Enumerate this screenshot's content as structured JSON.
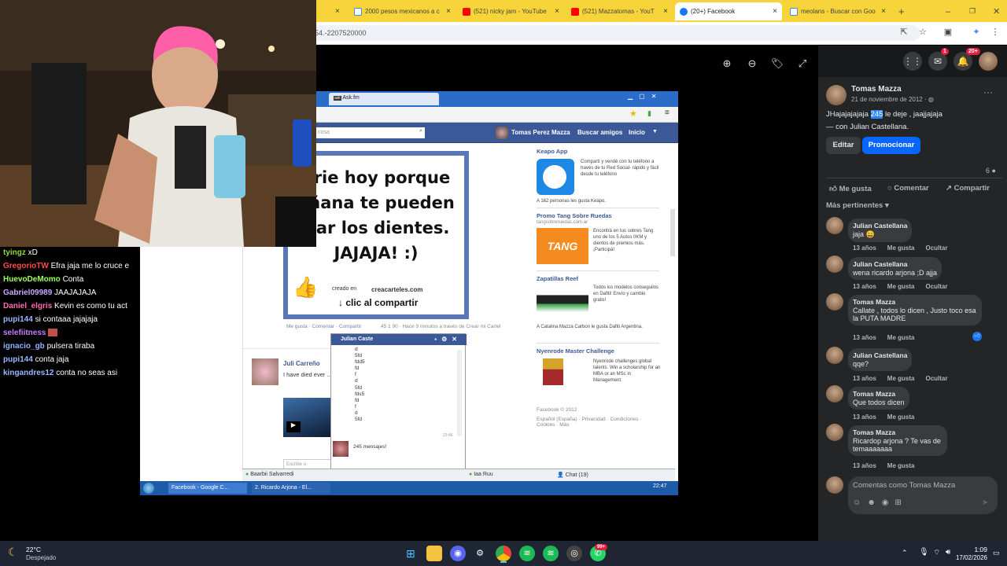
{
  "browser": {
    "tabs": [
      {
        "label": "2000 pesos mexicanos a c",
        "icon": "google-icon"
      },
      {
        "label": "(521) nicky jam - YouTube",
        "icon": "youtube-icon"
      },
      {
        "label": "(521) Mazzatomas - YouT",
        "icon": "youtube-icon"
      },
      {
        "label": "(20+) Facebook",
        "icon": "facebook-icon"
      },
      {
        "label": "meolans - Buscar con Goo",
        "icon": "google-icon"
      }
    ],
    "url_partial": "54.-2207520000"
  },
  "stream_chat": [
    {
      "user": "tyingz",
      "color": "#8fdc3a",
      "text": "xD"
    },
    {
      "user": "GregorioTW",
      "color": "#ff4b4b",
      "text": "Efra jaja me lo cruce e"
    },
    {
      "user": "HuevoDeMomo",
      "color": "#9bff5a",
      "text": "Conta"
    },
    {
      "user": "Gabriel09989",
      "color": "#c9a6ff",
      "text": "JAAJAJAJA"
    },
    {
      "user": "Daniel_elgris",
      "color": "#ff6bb1",
      "text": "Kevin es como tu act"
    },
    {
      "user": "pupi144",
      "color": "#9ab8ff",
      "text": "si contaaa jajajaja"
    },
    {
      "user": "selefiitness",
      "color": "#c77dff",
      "text": ""
    },
    {
      "user": "ignacio_gb",
      "color": "#8fb3ff",
      "text": "pulsera tiraba"
    },
    {
      "user": "pupi144",
      "color": "#9ab8ff",
      "text": "conta jaja"
    },
    {
      "user": "kingandres12",
      "color": "#9ab8ff",
      "text": "conta no seas asi"
    }
  ],
  "screenshot": {
    "tab_label": "Ask.fm",
    "profile_name": "Tomas Perez Mazza",
    "nav_find": "Buscar amigos",
    "nav_home": "Inicio",
    "search_placeholder": "cosa",
    "poster_lines": [
      "nrie hoy porque",
      "añana te pueden",
      "ltar los dientes.",
      "JAJAJA! :)"
    ],
    "poster_credit": "creado en",
    "poster_site": "creacarteles.com",
    "poster_cta": "clic al compartir",
    "post_actions": "Me gusta · Comentar · Compartir",
    "post_stats": "45   1   90 · Hace 9 minutos a través de Crear mi Cartel",
    "ads": [
      {
        "title": "Keapo App",
        "text": "Compartí y vendé con tu teléfono a través de tu Red Social- rápido y fácil desde tu teléfono",
        "foot": "A 162 personas les gusta Keapo."
      },
      {
        "title": "Promo Tang Sobre Ruedas",
        "sub": "tangsobreruedas.com.ar",
        "text": "Encontrá en tus sobres Tang uno de los 5 Autos 0KM y dientos de premios más. ¡Participá!",
        "logo": "TANG"
      },
      {
        "title": "Zapatillas Reef",
        "text": "Todos los modelos conseguilos en Dafiti! Envío y cambio gratis!",
        "foot": "A Catalina Mazza Carbon le gusta Dafiti Argentina."
      },
      {
        "title": "Nyenrode Master Challenge",
        "text": "Nyenrode challenges global talents. Win a scholarship for an MBA or an MSc in Management."
      }
    ],
    "footer": "Facebook © 2012",
    "footer_links": "Español (España) · Privacidad · Condiciones · Cookies · Más",
    "feed_name": "Juli Carreño",
    "feed_text": "I have died ever ... I have loved you for a ... ore.",
    "chat_name": "Julian Caste",
    "chat_lines": [
      "d",
      "5fd",
      "fdd5",
      "fd",
      "f",
      "d",
      "5fd",
      "fds5",
      "fd",
      "f",
      "d",
      "5fd"
    ],
    "chat_time": "23:46",
    "chat_count": "245 mensajes!",
    "chat_bar_items": [
      "Baarbii Salvarredi",
      "Iaa Ruu",
      "Chat (19)"
    ],
    "taskbar_items": [
      "Facebook - Google C...",
      "2. Ricardo Arjona - El..."
    ],
    "clock": "22:47",
    "feed_input": "Escribe u"
  },
  "facebook": {
    "badges": {
      "messenger": "1",
      "notifications": "20+"
    },
    "post": {
      "author": "Tomas Mazza",
      "date": "21 de noviembre de 2012 ·",
      "text_before": "JHajajajajaja",
      "text_highlight": "245",
      "text_after": "le deje , jaajjajaja",
      "tagged": "— con Julian Castellana.",
      "edit": "Editar",
      "promote": "Promocionar",
      "comment_count": "6",
      "like": "Me gusta",
      "comment": "Comentar",
      "share": "Compartir",
      "filter": "Más pertinentes"
    },
    "comments": [
      {
        "name": "Julian Castellana",
        "text": "jaja 😄",
        "age": "13 años",
        "like": "Me gusta",
        "hide": "Ocultar"
      },
      {
        "name": "Julian Castellana",
        "text": "wena ricardo arjona ;D ajja",
        "age": "13 años",
        "like": "Me gusta",
        "hide": "Ocultar"
      },
      {
        "name": "Tomas Mazza",
        "text": "Callate , todos lo dicen , Justo toco esa la PUTA MADRE",
        "age": "13 años",
        "like": "Me gusta",
        "hide": ""
      },
      {
        "name": "Julian Castellana",
        "text": "qqe?",
        "age": "13 años",
        "like": "Me gusta",
        "hide": "Ocultar"
      },
      {
        "name": "Tomas Mazza",
        "text": "Que todos dicen",
        "age": "13 años",
        "like": "Me gusta",
        "hide": ""
      },
      {
        "name": "Tomas Mazza",
        "text": "Ricardop arjona ? Te vas de temaaaaaaa",
        "age": "13 años",
        "like": "Me gusta",
        "hide": ""
      }
    ],
    "comment_placeholder": "Comentas como Tomas Mazza"
  },
  "taskbar": {
    "weather_temp": "22°C",
    "weather_desc": "Despejado",
    "time": "1:09",
    "date": "17/02/2026",
    "steam_badge": "99+"
  }
}
